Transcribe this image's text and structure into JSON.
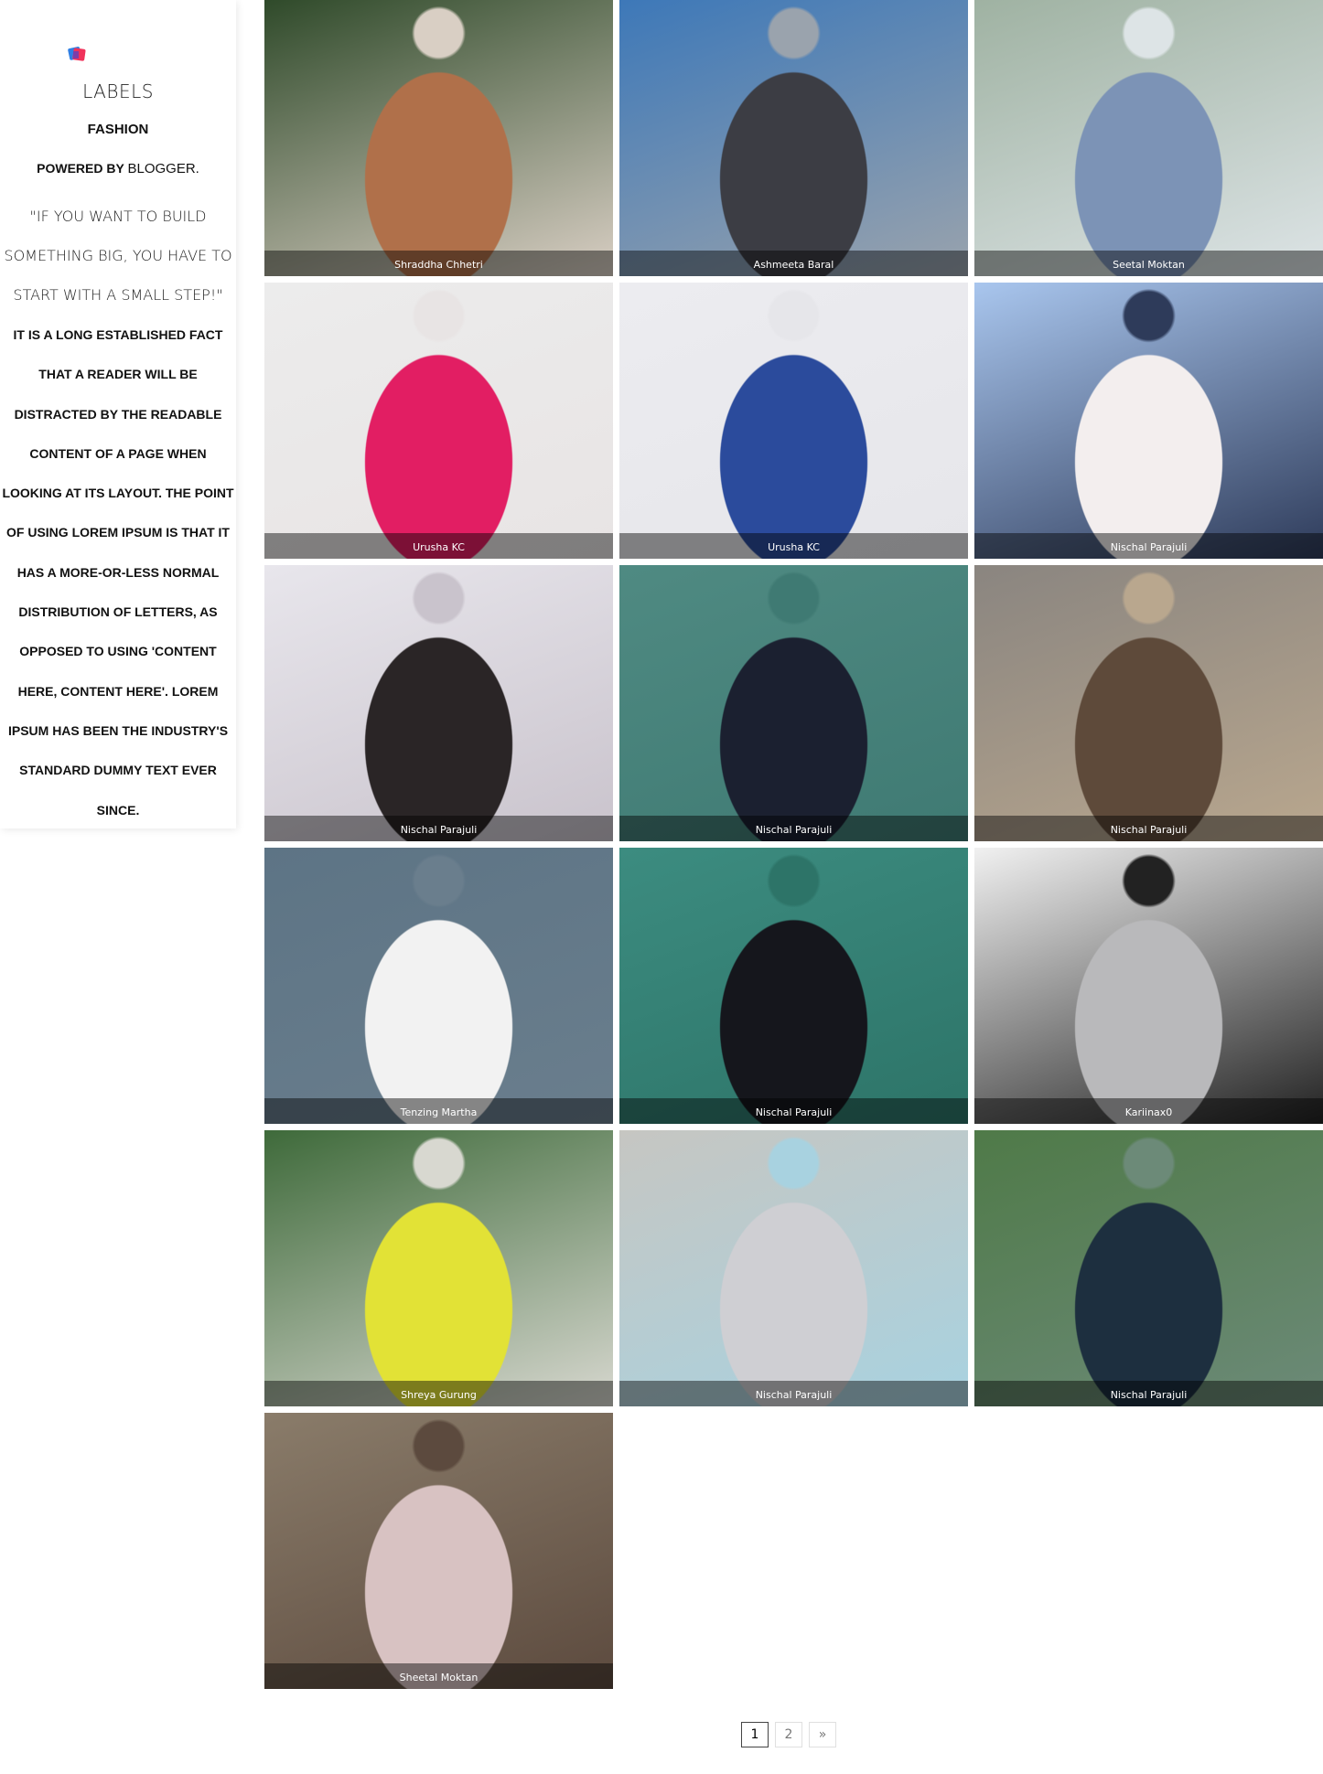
{
  "sidebar": {
    "labels_title": "Labels",
    "label_link": "Fashion",
    "powered_prefix": "Powered by ",
    "powered_link": "Blogger.",
    "quote": "\"If you want to build something big, you have to start with a small step!\"",
    "lorem": "It is a long established fact that a reader will be distracted by the readable content of a page when looking at its layout. The point of using Lorem Ipsum is that it has a more-or-less normal distribution of letters, as opposed to using 'Content here, content here'. Lorem Ipsum has been the industry's standard dummy text ever since."
  },
  "gallery": {
    "items": [
      {
        "caption": "Shraddha Chhetri",
        "colors": [
          "#2f4a2a",
          "#b0704a",
          "#d9cfc4"
        ]
      },
      {
        "caption": "Ashmeeta Baral",
        "colors": [
          "#3d78b8",
          "#3c3d44",
          "#9aa3ad"
        ]
      },
      {
        "caption": "Seetal Moktan",
        "colors": [
          "#9fb2a2",
          "#7c93b6",
          "#dde4e6"
        ]
      },
      {
        "caption": "Urusha KC",
        "colors": [
          "#ececec",
          "#e21e63",
          "#e8e4e4"
        ]
      },
      {
        "caption": "Urusha KC",
        "colors": [
          "#ececf0",
          "#2b4b9c",
          "#e6e6ea"
        ]
      },
      {
        "caption": "Nischal Parajuli",
        "colors": [
          "#a9c6ee",
          "#f3eeee",
          "#2e3b5a"
        ]
      },
      {
        "caption": "Nischal Parajuli",
        "colors": [
          "#e8e6ec",
          "#2a2526",
          "#c9c3cc"
        ]
      },
      {
        "caption": "Nischal Parajuli",
        "colors": [
          "#4f8a82",
          "#1b2030",
          "#3f7a73"
        ]
      },
      {
        "caption": "Nischal Parajuli",
        "colors": [
          "#8a8580",
          "#5e4a3a",
          "#b9a78e"
        ]
      },
      {
        "caption": "Tenzing Martha",
        "colors": [
          "#5d7485",
          "#f2f2f2",
          "#6a7e8d"
        ]
      },
      {
        "caption": "Nischal Parajuli",
        "colors": [
          "#3c8c80",
          "#15161c",
          "#2d7468"
        ]
      },
      {
        "caption": "Kariinax0",
        "colors": [
          "#f1f1f1",
          "#b9b9bb",
          "#222222"
        ]
      },
      {
        "caption": "Shreya Gurung",
        "colors": [
          "#3e6a3a",
          "#e2e236",
          "#d8d8d0"
        ]
      },
      {
        "caption": "Nischal Parajuli",
        "colors": [
          "#c6c6c2",
          "#cfcfd3",
          "#a8d2e0"
        ]
      },
      {
        "caption": "Nischal Parajuli",
        "colors": [
          "#4f7a48",
          "#1d2f3f",
          "#6c8a78"
        ]
      },
      {
        "caption": "Sheetal Moktan",
        "colors": [
          "#8a7c6a",
          "#d8c2c2",
          "#5c4a3e"
        ]
      }
    ]
  },
  "pagination": {
    "pages": [
      "1",
      "2"
    ],
    "next_label": "»"
  }
}
